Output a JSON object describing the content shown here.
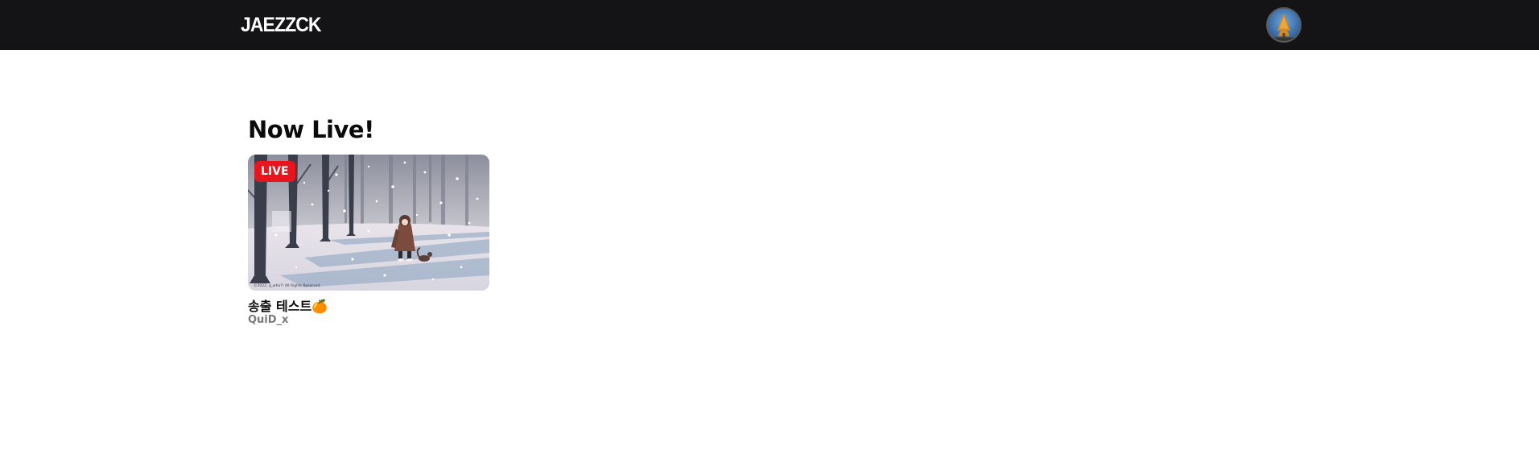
{
  "header": {
    "brand": "JAEZZCK",
    "avatar_icon": "user-avatar-autumn-tree"
  },
  "main": {
    "section_title": "Now Live!",
    "streams": [
      {
        "badge": "LIVE",
        "title": "송출 테스트🍊",
        "streamer": "QuiD_x",
        "thumbnail_icon": "snowy-forest-girl-thumbnail",
        "thumbnail_caption": "©2022, q_who?! All Rights Reserved."
      }
    ]
  },
  "colors": {
    "header_bg": "#141416",
    "live_badge": "#e8141e",
    "page_bg": "#ffffff"
  }
}
